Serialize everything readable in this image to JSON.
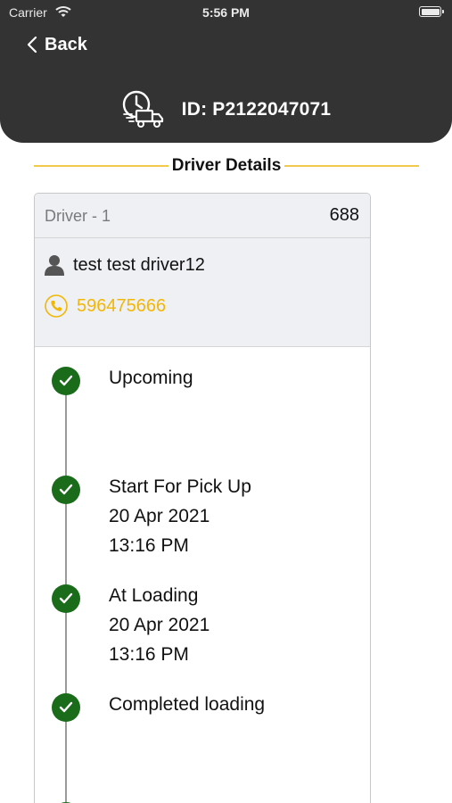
{
  "status_bar": {
    "carrier": "Carrier",
    "time": "5:56 PM"
  },
  "header": {
    "back_label": "Back",
    "order_id": "ID: P2122047071"
  },
  "section": {
    "title": "Driver Details"
  },
  "driver_card": {
    "driver_label": "Driver - 1",
    "driver_value": "688",
    "name": "test test driver12",
    "phone": "596475666"
  },
  "timeline": [
    {
      "status": "Upcoming",
      "date": "",
      "time": ""
    },
    {
      "status": "Start For Pick Up",
      "date": "20 Apr 2021",
      "time": "13:16 PM"
    },
    {
      "status": "At Loading",
      "date": "20 Apr 2021",
      "time": "13:16 PM"
    },
    {
      "status": "Completed loading",
      "date": "",
      "time": ""
    }
  ],
  "colors": {
    "header_bg": "#333333",
    "accent": "#f2c94c",
    "phone_text": "#f2b705",
    "check_green": "#1a6b1a"
  },
  "icons": {
    "back": "chevron-left-icon",
    "truck": "clock-truck-icon",
    "person": "person-icon",
    "phone": "phone-icon",
    "check": "check-icon"
  }
}
